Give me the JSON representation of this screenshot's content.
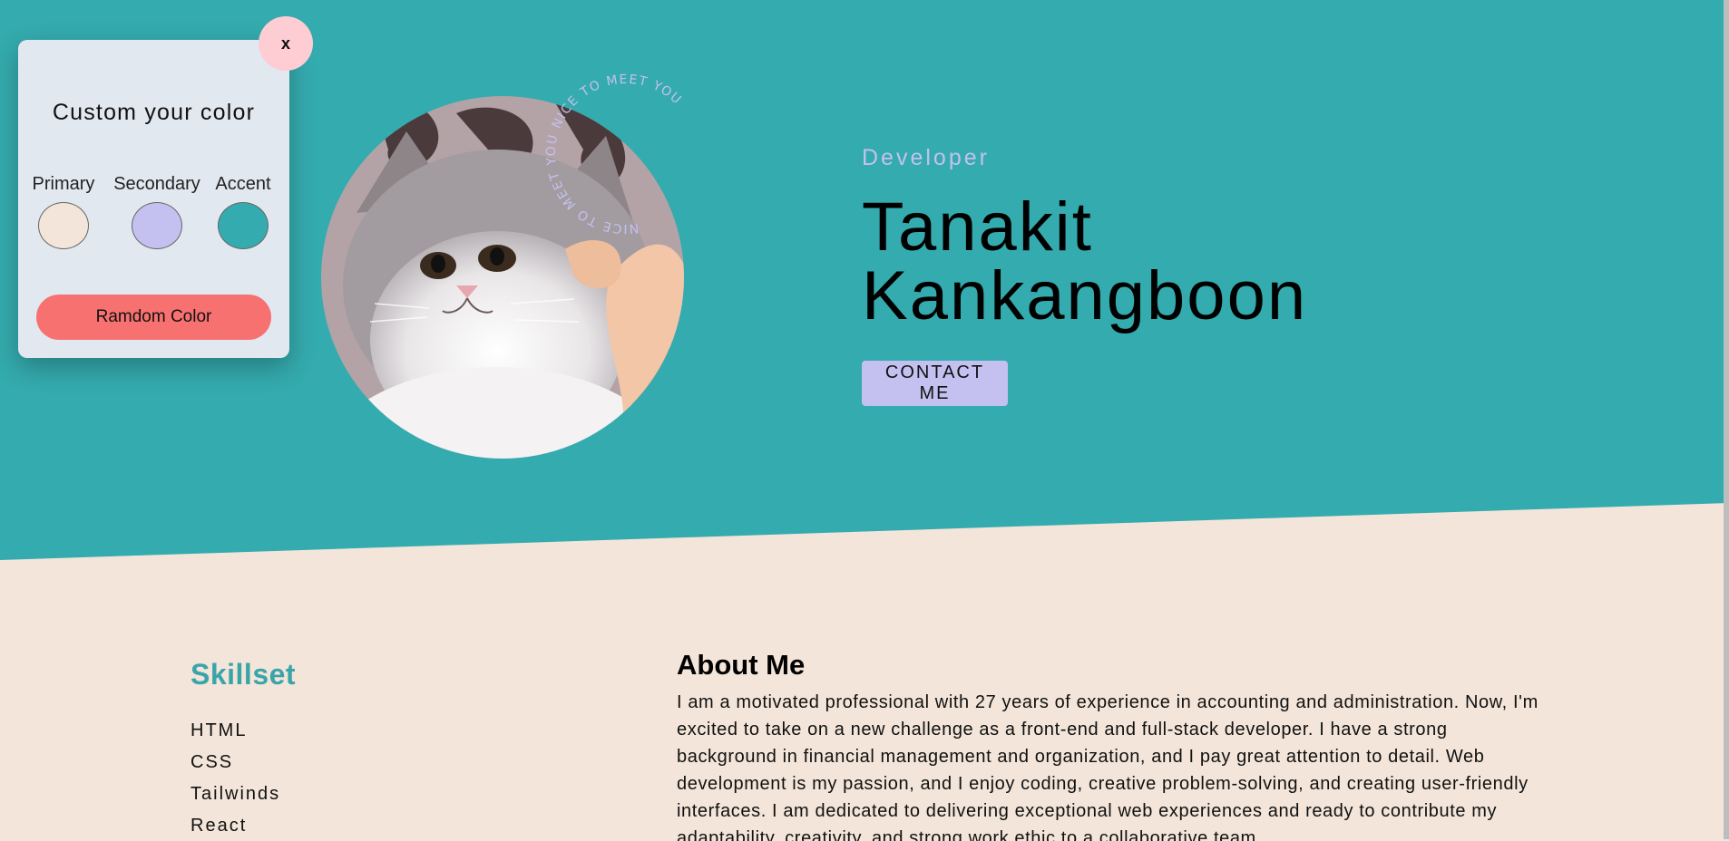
{
  "colors": {
    "primary": "#f3e5d9",
    "secondary": "#c4c0f0",
    "accent": "#34abae",
    "close_button": "#fecdd3",
    "random_button": "#f87171",
    "panel_bg": "#e2e8f0"
  },
  "color_panel": {
    "close_label": "x",
    "title": "Custom your color",
    "swatches": [
      {
        "label": "Primary",
        "color": "#f3e5d9"
      },
      {
        "label": "Secondary",
        "color": "#c4c0f0"
      },
      {
        "label": "Accent",
        "color": "#34abae"
      }
    ],
    "random_label": "Ramdom Color"
  },
  "hero": {
    "circular_text": "NICE TO MEET YOU  NICE TO MEET YOU  ",
    "role": "Developer",
    "name_line1": "Tanakit",
    "name_line2": "Kankangboon",
    "contact_label": "CONTACT ME"
  },
  "skills": {
    "title": "Skillset",
    "items": [
      "HTML",
      "CSS",
      "Tailwinds",
      "React"
    ]
  },
  "about": {
    "title": "About Me",
    "text": "I am a motivated professional with 27 years of experience in accounting and administration. Now, I'm excited to take on a new challenge as a front-end and full-stack developer. I have a strong background in financial management and organization, and I pay great attention to detail. Web development is my passion, and I enjoy coding, creative problem-solving, and creating user-friendly interfaces. I am dedicated to delivering exceptional web experiences and ready to contribute my adaptability, creativity, and strong work ethic to a collaborative team."
  }
}
